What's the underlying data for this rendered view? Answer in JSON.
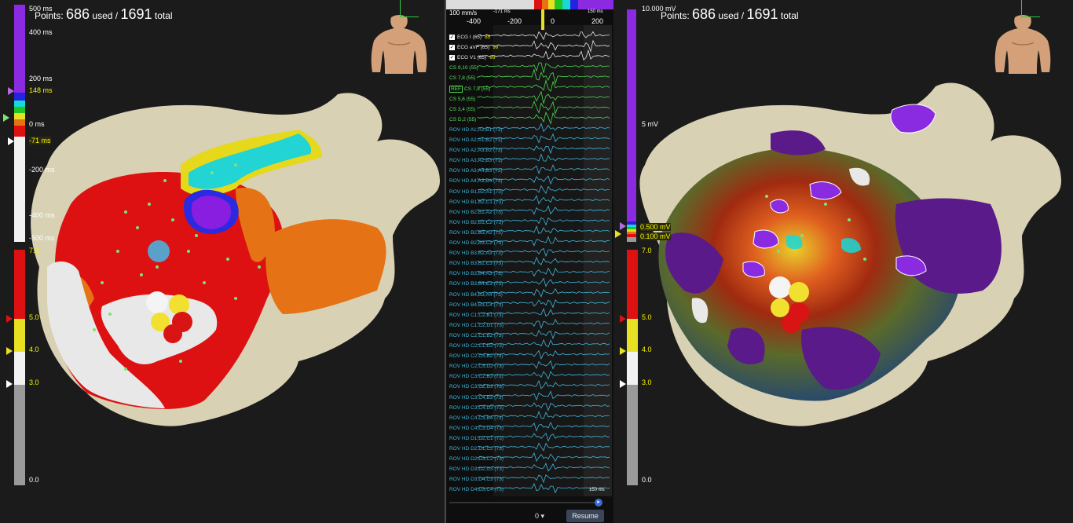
{
  "left_map": {
    "points_prefix": "Points:",
    "points_used": "686",
    "used_label": "used /",
    "points_total": "1691",
    "total_label": "total",
    "lat_scale": {
      "labels": [
        "500 ms",
        "400 ms",
        "200 ms",
        "148 ms",
        "0 ms",
        "-71 ms",
        "-200 ms",
        "-400 ms",
        "-500 ms"
      ]
    },
    "voltage_scale": {
      "labels": [
        "7.0",
        "5.0",
        "4.0",
        "3.0",
        "0.0"
      ]
    }
  },
  "right_map": {
    "points_prefix": "Points:",
    "points_used": "686",
    "used_label": "used /",
    "points_total": "1691",
    "total_label": "total",
    "bipolar_scale": {
      "labels": [
        "10.000 mV",
        "5 mV",
        "0.500 mV",
        "0.100 mV"
      ]
    },
    "voltage_scale": {
      "labels": [
        "7.0",
        "5.0",
        "4.0",
        "3.0",
        "0.0"
      ]
    }
  },
  "ecg": {
    "sweep_speed": "100 mm/s",
    "window_start": "-171 ms",
    "window_end": "150 ms",
    "ticks": [
      "-400",
      "-200",
      "0",
      "200"
    ],
    "scale_bar": "150 ms",
    "zero_value": "0",
    "resume_label": "Resume",
    "channels": [
      {
        "label": "ECG I (65)",
        "value": "85",
        "color": "white",
        "checked": true
      },
      {
        "label": "ECG aVF (65)",
        "value": "99",
        "color": "white",
        "checked": true
      },
      {
        "label": "ECG V1 (65)",
        "value": "99",
        "color": "white",
        "checked": true
      },
      {
        "label": "CS 9,10 (55)",
        "color": "green"
      },
      {
        "label": "CS 7,8 (55)",
        "color": "green"
      },
      {
        "label": "CS 7,8 (55)",
        "color": "green",
        "ref": "REF"
      },
      {
        "label": "CS 5,6 (55)",
        "color": "green"
      },
      {
        "label": "CS 3,4 (55)",
        "color": "green"
      },
      {
        "label": "CS D,2 (55)",
        "color": "green"
      },
      {
        "label": "ROV HD  A1,A2,B1 (73)",
        "color": "cyan"
      },
      {
        "label": "ROV HD  A2,A1,B2 (73)",
        "color": "cyan"
      },
      {
        "label": "ROV HD  A2,A3,B2 (73)",
        "color": "cyan"
      },
      {
        "label": "ROV HD  A3,A2,B3 (73)",
        "color": "cyan"
      },
      {
        "label": "ROV HD  A3,A4,B3 (73)",
        "color": "cyan"
      },
      {
        "label": "ROV HD  A4,A3,B4 (73)",
        "color": "cyan"
      },
      {
        "label": "ROV HD  B1,B2,A1 (73)",
        "color": "cyan"
      },
      {
        "label": "ROV HD  B1,B2,C1 (73)",
        "color": "cyan"
      },
      {
        "label": "ROV HD  B2,B1,A2 (73)",
        "color": "cyan"
      },
      {
        "label": "ROV HD  B2,B1,C2 (73)",
        "color": "cyan"
      },
      {
        "label": "ROV HD  B2,B3,A2 (73)",
        "color": "cyan"
      },
      {
        "label": "ROV HD  B2,B3,C2 (73)",
        "color": "cyan"
      },
      {
        "label": "ROV HD  B3,B2,A3 (73)",
        "color": "cyan"
      },
      {
        "label": "ROV HD  B3,B2,C3 (73)",
        "color": "cyan"
      },
      {
        "label": "ROV HD  B3,B4,A3 (73)",
        "color": "cyan"
      },
      {
        "label": "ROV HD  B3,B4,C3 (73)",
        "color": "cyan"
      },
      {
        "label": "ROV HD  B4,B3,A4 (73)",
        "color": "cyan"
      },
      {
        "label": "ROV HD  B4,B3,C4 (73)",
        "color": "cyan"
      },
      {
        "label": "ROV HD  C1,C2,B1 (73)",
        "color": "cyan"
      },
      {
        "label": "ROV HD  C1,C2,D1 (73)",
        "color": "cyan"
      },
      {
        "label": "ROV HD  C2,C1,B2 (73)",
        "color": "cyan"
      },
      {
        "label": "ROV HD  C2,C1,D2 (73)",
        "color": "cyan"
      },
      {
        "label": "ROV HD  C2,C3,B2 (73)",
        "color": "cyan"
      },
      {
        "label": "ROV HD  C2,C3,D2 (73)",
        "color": "cyan"
      },
      {
        "label": "ROV HD  C3,C2,B3 (73)",
        "color": "cyan"
      },
      {
        "label": "ROV HD  C3,C2,D3 (73)",
        "color": "cyan"
      },
      {
        "label": "ROV HD  C3,C4,B3 (73)",
        "color": "cyan"
      },
      {
        "label": "ROV HD  C3,C4,D3 (73)",
        "color": "cyan"
      },
      {
        "label": "ROV HD  C4,C3,B4 (73)",
        "color": "cyan"
      },
      {
        "label": "ROV HD  C4,C3,D4 (73)",
        "color": "cyan"
      },
      {
        "label": "ROV HD  D1,D2,C1 (73)",
        "color": "cyan"
      },
      {
        "label": "ROV HD  D2,D1,C2 (73)",
        "color": "cyan"
      },
      {
        "label": "ROV HD  D2,D3,C2 (73)",
        "color": "cyan"
      },
      {
        "label": "ROV HD  D3,D2,C3 (73)",
        "color": "cyan"
      },
      {
        "label": "ROV HD  D3,D4,C3 (73)",
        "color": "cyan"
      },
      {
        "label": "ROV HD  D4,D3,C4 (73)",
        "color": "cyan"
      }
    ]
  }
}
